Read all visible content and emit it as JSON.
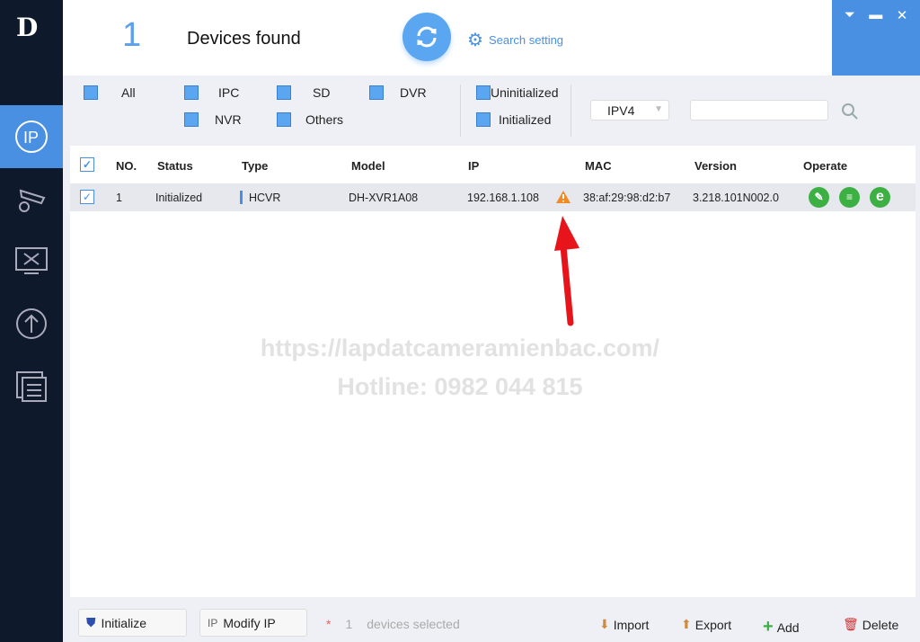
{
  "header": {
    "count": "1",
    "found_label": "Devices found",
    "search_setting": "Search setting"
  },
  "filters": {
    "all": "All",
    "ipc": "IPC",
    "sd": "SD",
    "dvr": "DVR",
    "nvr": "NVR",
    "others": "Others",
    "uninitialized": "Uninitialized",
    "initialized": "Initialized",
    "ip_version": "IPV4",
    "search_value": ""
  },
  "table": {
    "headers": [
      "NO.",
      "Status",
      "Type",
      "Model",
      "IP",
      "MAC",
      "Version",
      "Operate"
    ],
    "rows": [
      {
        "no": "1",
        "status": "Initialized",
        "type": "HCVR",
        "model": "DH-XVR1A08",
        "ip": "192.168.1.108",
        "mac": "38:af:29:98:d2:b7",
        "version": "3.218.101N002.0",
        "warning": true
      }
    ]
  },
  "watermark": {
    "line1": "https://lapdatcameramienbac.com/",
    "line2": "Hotline: 0982 044 815"
  },
  "footer": {
    "initialize": "Initialize",
    "modify_ip": "Modify IP",
    "asterisk": "*",
    "selected_count": "1",
    "selected_label": "devices selected",
    "import": "Import",
    "export": "Export",
    "add": "Add",
    "delete": "Delete"
  },
  "colors": {
    "accent": "#4a90e2",
    "sidebar": "#0e1a2b",
    "warning": "#f08a24",
    "operate": "#3cb043",
    "annotation_arrow": "#e8141c"
  }
}
